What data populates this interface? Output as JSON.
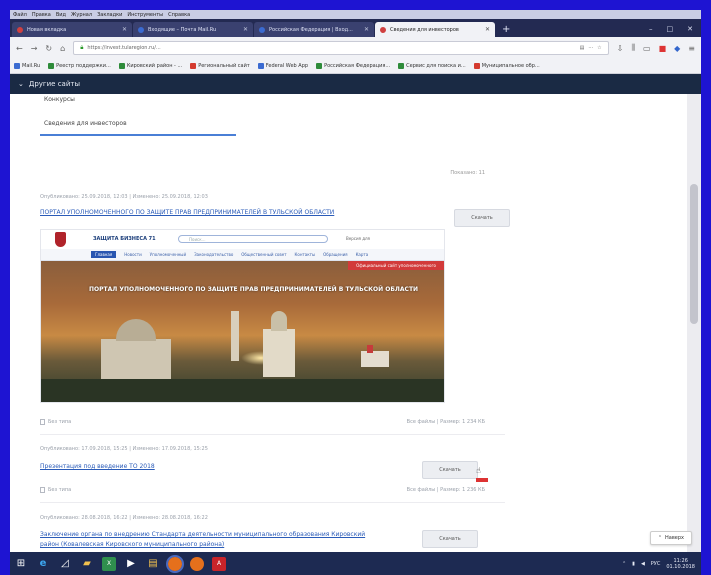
{
  "menubar": {
    "items": [
      "Файл",
      "Правка",
      "Вид",
      "Журнал",
      "Закладки",
      "Инструменты",
      "Справка"
    ]
  },
  "tabs": [
    {
      "label": "Новая вкладка",
      "active": false
    },
    {
      "label": "Входящие – Почта Mail.Ru",
      "active": false
    },
    {
      "label": "Российская Федерация | Вход...",
      "active": false
    },
    {
      "label": "Сведения для инвесторов",
      "active": true
    }
  ],
  "navbar": {
    "url": "https://invest.tularegion.ru/..."
  },
  "bookmarks": [
    "Mail.Ru",
    "Реестр поддержки...",
    "Кировский район - ...",
    "Региональный сайт",
    "Federal Web App",
    "Российская Федерация...",
    "Сервис для поиска и...",
    "Муниципальное обр..."
  ],
  "sitebar": {
    "title": "Другие сайты"
  },
  "nav": {
    "konkursy": "Конкурсы",
    "investors": "Сведения для инвесторов"
  },
  "count": "Показано: 11",
  "items": [
    {
      "meta": "Опубликовано: 25.09.2018, 12:03 | Изменено: 25.09.2018, 12:03",
      "title": "ПОРТАЛ УПОЛНОМОЧЕННОГО ПО ЗАЩИТЕ ПРАВ ПРЕДПРИНИМАТЕЛЕЙ В ТУЛЬСКОЙ ОБЛАСТИ",
      "button": "Скачать",
      "file": "Без типа",
      "size": "Все файлы  |  Размер: 1 234 КБ"
    },
    {
      "meta": "Опубликовано: 17.09.2018, 15:25 | Изменено: 17.09.2018, 15:25",
      "title": "Презентация под введение ТО 2018",
      "button": "Скачать",
      "file": "Без типа",
      "size": "Все файлы  |  Размер: 1 236 КБ"
    },
    {
      "meta": "Опубликовано: 28.08.2018, 16:22 | Изменено: 28.08.2018, 16:22",
      "title": "Заключение органа по внедрению Стандарта деятельности муниципального образования Кировский район (Ковалевская Кировского муниципального района)",
      "button": "Скачать"
    }
  ],
  "preview": {
    "logo": "ЗАЩИТА БИЗНЕСА 71",
    "search_placeholder": "Поиск...",
    "lang": "Версия для",
    "nav": [
      "Главная",
      "Новости",
      "Уполномоченный",
      "Законодательство",
      "Общественный совет",
      "Контакты",
      "Обращения",
      "Карта"
    ],
    "badge": "Официальный сайт уполномоченного",
    "caption": "ПОРТАЛ УПОЛНОМОЧЕННОГО ПО ЗАЩИТЕ ПРАВ ПРЕДПРИНИМАТЕЛЕЙ В ТУЛЬСКОЙ ОБЛАСТИ"
  },
  "back_button": "Наверх",
  "taskbar": {
    "time": "11:26",
    "date": "01.10.2018",
    "lang": "РУС"
  },
  "colors": {
    "link": "#2a5bb8",
    "accent": "#4a7fd6",
    "sitebar": "#1a2a44",
    "frame": "#1e14d2"
  }
}
